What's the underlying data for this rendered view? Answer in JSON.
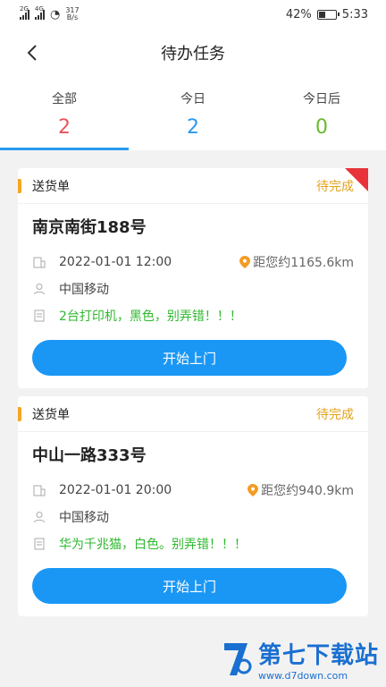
{
  "statusbar": {
    "net1": "2G",
    "net2": "4G",
    "speed_value": "317",
    "speed_unit": "B/s",
    "battery": "42%",
    "time": "5:33",
    "battery_level": 0.42
  },
  "nav": {
    "title": "待办任务",
    "back_icon": "chevron-left-icon"
  },
  "tabs": [
    {
      "label": "全部",
      "count": "2",
      "color": "#e8555a",
      "active": true
    },
    {
      "label": "今日",
      "count": "2",
      "color": "#2a9af0",
      "active": false
    },
    {
      "label": "今日后",
      "count": "0",
      "color": "#6ab82e",
      "active": false
    }
  ],
  "tasks": [
    {
      "type": "送货单",
      "status": "待完成",
      "address": "南京南街188号",
      "datetime": "2022-01-01 12:00",
      "distance": "距您约1165.6km",
      "company": "中国移动",
      "note": "2台打印机，黑色，别弄错！！！",
      "button": "开始上门"
    },
    {
      "type": "送货单",
      "status": "待完成",
      "address": "中山一路333号",
      "datetime": "2022-01-01 20:00",
      "distance": "距您约940.9km",
      "company": "中国移动",
      "note": "华为千兆猫，白色。别弄错！！！",
      "button": "开始上门"
    }
  ],
  "watermark": {
    "main": "第七下载站",
    "sub": "www.d7down.com"
  },
  "colors": {
    "accent": "#1a97f5",
    "pending": "#e3a21a",
    "note": "#2eb82e"
  }
}
